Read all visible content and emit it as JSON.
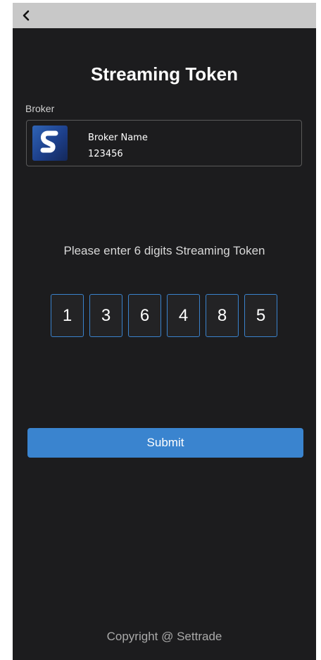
{
  "header": {
    "back_icon": "chevron-left-icon"
  },
  "page": {
    "title": "Streaming Token"
  },
  "broker": {
    "section_label": "Broker",
    "logo_icon": "settrade-logo",
    "name": "Broker Name",
    "id": "123456"
  },
  "token": {
    "prompt": "Please enter 6 digits Streaming Token",
    "digits": [
      "1",
      "3",
      "6",
      "4",
      "8",
      "5"
    ]
  },
  "actions": {
    "submit_label": "Submit"
  },
  "footer": {
    "copyright": "Copyright @ Settrade"
  },
  "colors": {
    "background": "#1c1c1e",
    "top_bar": "#c8c8c8",
    "accent": "#3a84cf",
    "digit_border": "#3a82cc"
  }
}
